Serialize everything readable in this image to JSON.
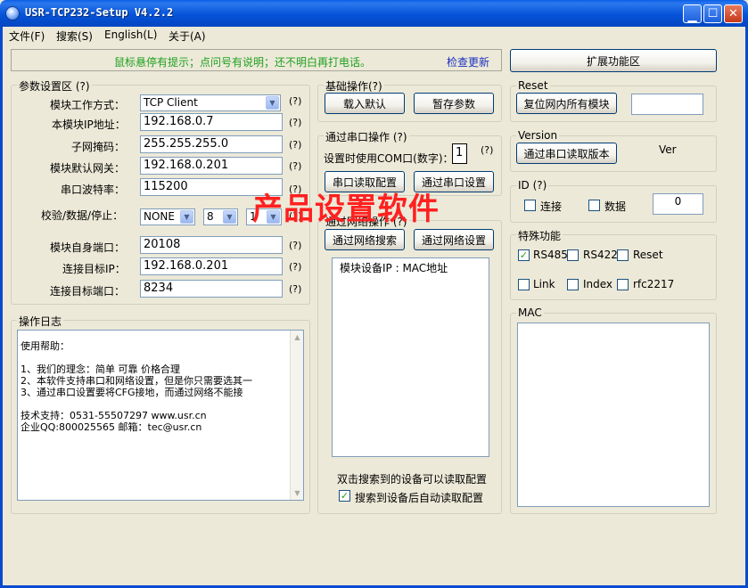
{
  "window": {
    "title": "USR-TCP232-Setup V4.2.2"
  },
  "menu": [
    "文件(F)",
    "搜索(S)",
    "English(L)",
    "关于(A)"
  ],
  "hint": {
    "text": "鼠标悬停有提示；点问号有说明；还不明白再打电话。",
    "update_link": "检查更新"
  },
  "ext_button": "扩展功能区",
  "params": {
    "legend": "参数设置区 (?)",
    "work_mode_label": "模块工作方式：",
    "work_mode_value": "TCP Client",
    "ip_label": "本模块IP地址：",
    "ip_value": "192.168.0.7",
    "mask_label": "子网掩码：",
    "mask_value": "255.255.255.0",
    "gateway_label": "模块默认网关：",
    "gateway_value": "192.168.0.201",
    "baud_label": "串口波特率：",
    "baud_value": "115200",
    "parity_label": "校验/数据/停止：",
    "parity_value": "NONE",
    "data_bits_value": "8",
    "stop_bits_value": "1",
    "local_port_label": "模块自身端口：",
    "local_port_value": "20108",
    "target_ip_label": "连接目标IP：",
    "target_ip_value": "192.168.0.201",
    "target_port_label": "连接目标端口：",
    "target_port_value": "8234",
    "help_mark": "(?)"
  },
  "log": {
    "legend": "操作日志",
    "lines": [
      "使用帮助：",
      "",
      "1、我们的理念：简单 可靠 价格合理",
      "2、本软件支持串口和网络设置，但是你只需要选其一",
      "3、通过串口设置要将CFG接地，而通过网络不能接",
      "",
      "技术支持：0531-55507297 www.usr.cn",
      "企业QQ:800025565 邮箱：tec@usr.cn"
    ]
  },
  "basic": {
    "legend": "基础操作(?)",
    "load_default": "载入默认",
    "save_params": "暂存参数"
  },
  "serial": {
    "legend": "通过串口操作 (?)",
    "com_label": "设置时使用COM口(数字)：",
    "com_value": "1",
    "help_mark": "(?)",
    "read_config": "串口读取配置",
    "write_config": "通过串口设置"
  },
  "network": {
    "legend": "通过网络操作 (?)",
    "search": "通过网络搜索",
    "setup": "通过网络设置",
    "list_header": "模块设备IP : MAC地址",
    "double_click_hint": "双击搜索到的设备可以读取配置",
    "auto_read_label": "搜索到设备后自动读取配置",
    "auto_read_checked": true
  },
  "watermark": "产品设置软件",
  "reset": {
    "legend": "Reset",
    "button": "复位网内所有模块",
    "value": ""
  },
  "version": {
    "legend": "Version",
    "button": "通过串口读取版本",
    "ver_label": "Ver"
  },
  "id": {
    "legend": "ID (?)",
    "connect_label": "连接",
    "data_label": "数据",
    "value": "0"
  },
  "special": {
    "legend": "特殊功能",
    "rs485": "RS485",
    "rs485_checked": true,
    "rs422": "RS422",
    "reset": "Reset",
    "link": "Link",
    "index": "Index",
    "rfc2217": "rfc2217"
  },
  "mac": {
    "legend": "MAC"
  },
  "colors": {
    "hint": "#20a020",
    "link": "#1a2fbf",
    "watermark": "#ff2020",
    "titlebar": "#0553d9"
  }
}
